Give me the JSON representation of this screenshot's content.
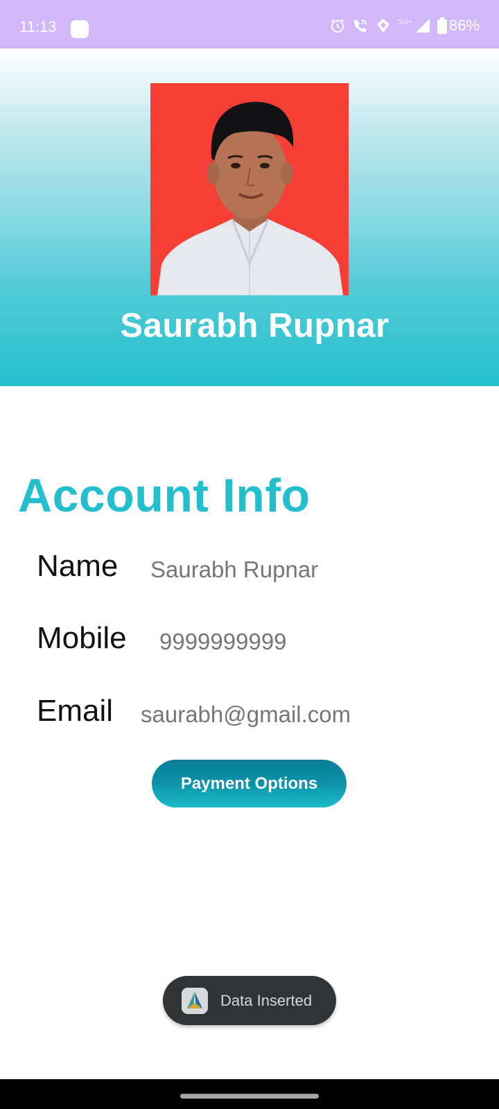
{
  "status_bar": {
    "time": "11:13",
    "network_label": "5G+",
    "battery": "86%",
    "icons": [
      "alarm-icon",
      "wifi-calling-icon",
      "data-saver-icon",
      "signal-icon",
      "battery-icon"
    ]
  },
  "profile": {
    "name": "Saurabh Rupnar",
    "photo_background": "#f43f36"
  },
  "account_info": {
    "title": "Account Info",
    "fields": {
      "name_label": "Name",
      "name_value": "Saurabh Rupnar",
      "mobile_label": "Mobile",
      "mobile_value": "9999999999",
      "email_label": "Email",
      "email_value": "saurabh@gmail.com"
    }
  },
  "actions": {
    "payment_options_label": "Payment Options"
  },
  "toast": {
    "message": "Data Inserted",
    "icon": "app-logo-icon"
  },
  "colors": {
    "accent": "#24bfcf",
    "status_bar": "#d1b8fb",
    "button_dark": "#0a7d95"
  }
}
